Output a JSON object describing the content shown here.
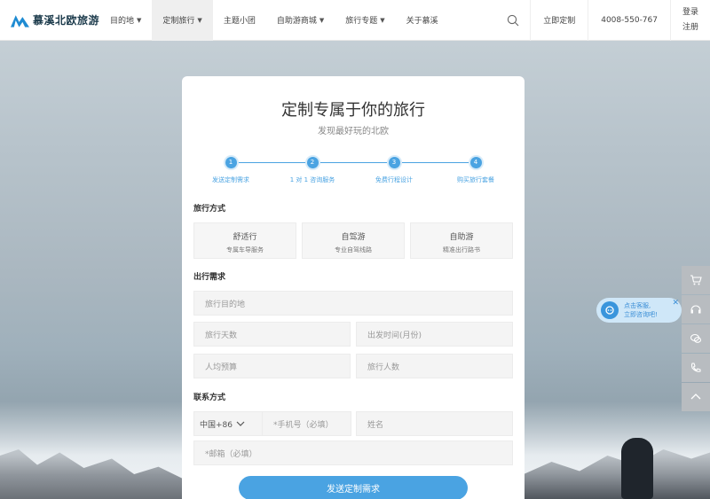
{
  "header": {
    "logo_text": "慕溪北欧旅游",
    "nav": [
      {
        "label": "目的地",
        "caret": true
      },
      {
        "label": "定制旅行",
        "caret": true,
        "active": true
      },
      {
        "label": "主题小团",
        "caret": false
      },
      {
        "label": "自助游商城",
        "caret": true
      },
      {
        "label": "旅行专题",
        "caret": true
      },
      {
        "label": "关于慕溪",
        "caret": false
      }
    ],
    "custom_link": "立即定制",
    "phone": "4008-550-767",
    "login": "登录",
    "register": "注册"
  },
  "form": {
    "title": "定制专属于你的旅行",
    "subtitle": "发现最好玩的北欧",
    "steps": [
      {
        "num": "1",
        "label": "发送定制需求"
      },
      {
        "num": "2",
        "label": "1 对 1 咨询服务"
      },
      {
        "num": "3",
        "label": "免费行程设计"
      },
      {
        "num": "4",
        "label": "购买旅行套餐"
      }
    ],
    "travel_mode_label": "旅行方式",
    "travel_modes": [
      {
        "name": "舒适行",
        "desc": "专属车导服务"
      },
      {
        "name": "自驾游",
        "desc": "专业自驾线路"
      },
      {
        "name": "自助游",
        "desc": "精准出行路书"
      }
    ],
    "needs_label": "出行需求",
    "destination_placeholder": "旅行目的地",
    "days_placeholder": "旅行天数",
    "depart_placeholder": "出发时间(月份)",
    "budget_placeholder": "人均预算",
    "people_placeholder": "旅行人数",
    "contact_label": "联系方式",
    "country_code": "中国+86",
    "phone_placeholder": "*手机号（必填）",
    "name_placeholder": "姓名",
    "email_placeholder": "*邮箱（必填）",
    "submit_label": "发送定制需求"
  },
  "chat": {
    "line1": "点击客服,",
    "line2": "立即咨询吧!",
    "close": "✕"
  },
  "colors": {
    "accent": "#4aa3e2",
    "logo": "#1e8bd2"
  }
}
